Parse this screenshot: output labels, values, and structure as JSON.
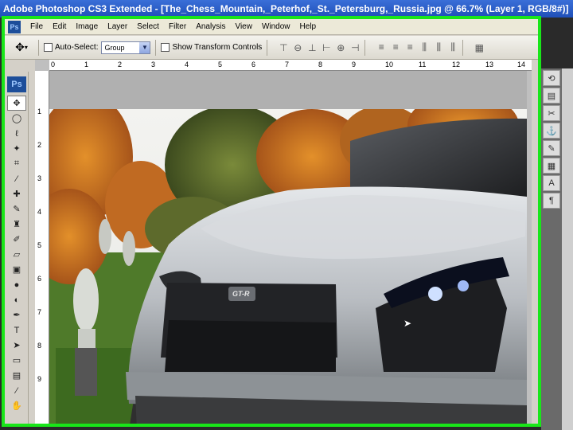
{
  "window": {
    "title": "Adobe Photoshop CS3 Extended - [The_Chess_Mountain,_Peterhof,_St._Petersburg,_Russia.jpg @ 66.7% (Layer 1, RGB/8#)]"
  },
  "menubar": {
    "app_icon": "Ps",
    "items": [
      "File",
      "Edit",
      "Image",
      "Layer",
      "Select",
      "Filter",
      "Analysis",
      "View",
      "Window",
      "Help"
    ]
  },
  "options": {
    "auto_select_label": "Auto-Select:",
    "auto_select_value": "Group",
    "show_transform_label": "Show Transform Controls"
  },
  "toolbox": {
    "logo": "Ps",
    "tools": [
      "move-tool",
      "marquee-tool",
      "lasso-tool",
      "magic-wand-tool",
      "crop-tool",
      "eyedropper-tool",
      "healing-brush-tool",
      "brush-tool",
      "clone-stamp-tool",
      "history-brush-tool",
      "eraser-tool",
      "gradient-tool",
      "blur-tool",
      "dodge-tool",
      "pen-tool",
      "type-tool",
      "path-selection-tool",
      "shape-tool",
      "notes-tool",
      "eyedropper2-tool",
      "hand-tool"
    ],
    "type_tool_glyph": "T"
  },
  "ruler": {
    "h_numbers": [
      "0",
      "1",
      "2",
      "3",
      "4",
      "5",
      "6",
      "7",
      "8",
      "9",
      "10",
      "11",
      "12",
      "13",
      "14"
    ],
    "v_numbers": [
      "1",
      "2",
      "3",
      "4",
      "5",
      "6",
      "7",
      "8",
      "9"
    ]
  },
  "car_badge": "GT-R",
  "colors": {
    "frame_highlight": "#19e619",
    "titlebar": "#1f4fb8",
    "car_body": "#b8bcc0"
  }
}
